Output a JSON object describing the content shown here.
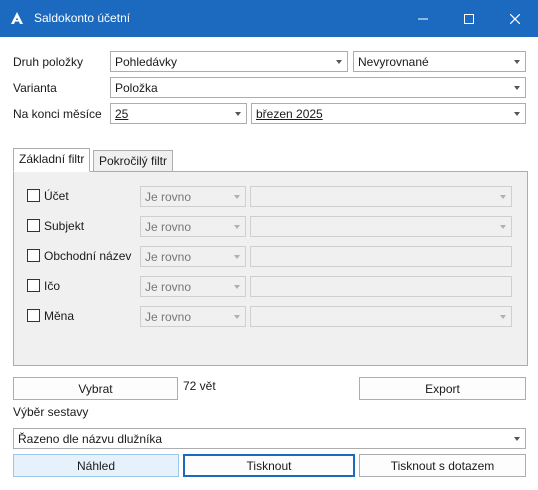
{
  "window": {
    "title": "Saldokonto účetní",
    "app_icon": "app-logo-icon",
    "controls": [
      "minimize-icon",
      "maximize-icon",
      "close-icon"
    ]
  },
  "form": {
    "druh_label": "Druh položky",
    "druh_value": "Pohledávky",
    "stav_value": "Nevyrovnané",
    "varianta_label": "Varianta",
    "varianta_value": "Položka",
    "konec_label": "Na konci měsíce",
    "den_value": "25",
    "mesic_value": "březen 2025"
  },
  "tabs": [
    {
      "label": "Základní filtr",
      "active": true
    },
    {
      "label": "Pokročilý filtr",
      "active": false
    }
  ],
  "filters": [
    {
      "label": "Účet",
      "operator": "Je rovno",
      "checked": false,
      "value_has_dropdown": true
    },
    {
      "label": "Subjekt",
      "operator": "Je rovno",
      "checked": false,
      "value_has_dropdown": true
    },
    {
      "label": "Obchodní název",
      "operator": "Je rovno",
      "checked": false,
      "value_has_dropdown": false
    },
    {
      "label": "Ičo",
      "operator": "Je rovno",
      "checked": false,
      "value_has_dropdown": false
    },
    {
      "label": "Měna",
      "operator": "Je rovno",
      "checked": false,
      "value_has_dropdown": true
    }
  ],
  "actions": {
    "vybrat_label": "Vybrat",
    "count_text": "72 vět",
    "export_label": "Export",
    "vyber_sestavy_label": "Výběr sestavy",
    "sestava_value": "Řazeno dle názvu dlužníka",
    "nahled_label": "Náhled",
    "tisknout_label": "Tisknout",
    "tisknout_dotaz_label": "Tisknout s dotazem"
  },
  "colors": {
    "titlebar": "#1c6ac0",
    "panel": "#f0f0f0",
    "highlight_button": "#e5f1fb"
  }
}
